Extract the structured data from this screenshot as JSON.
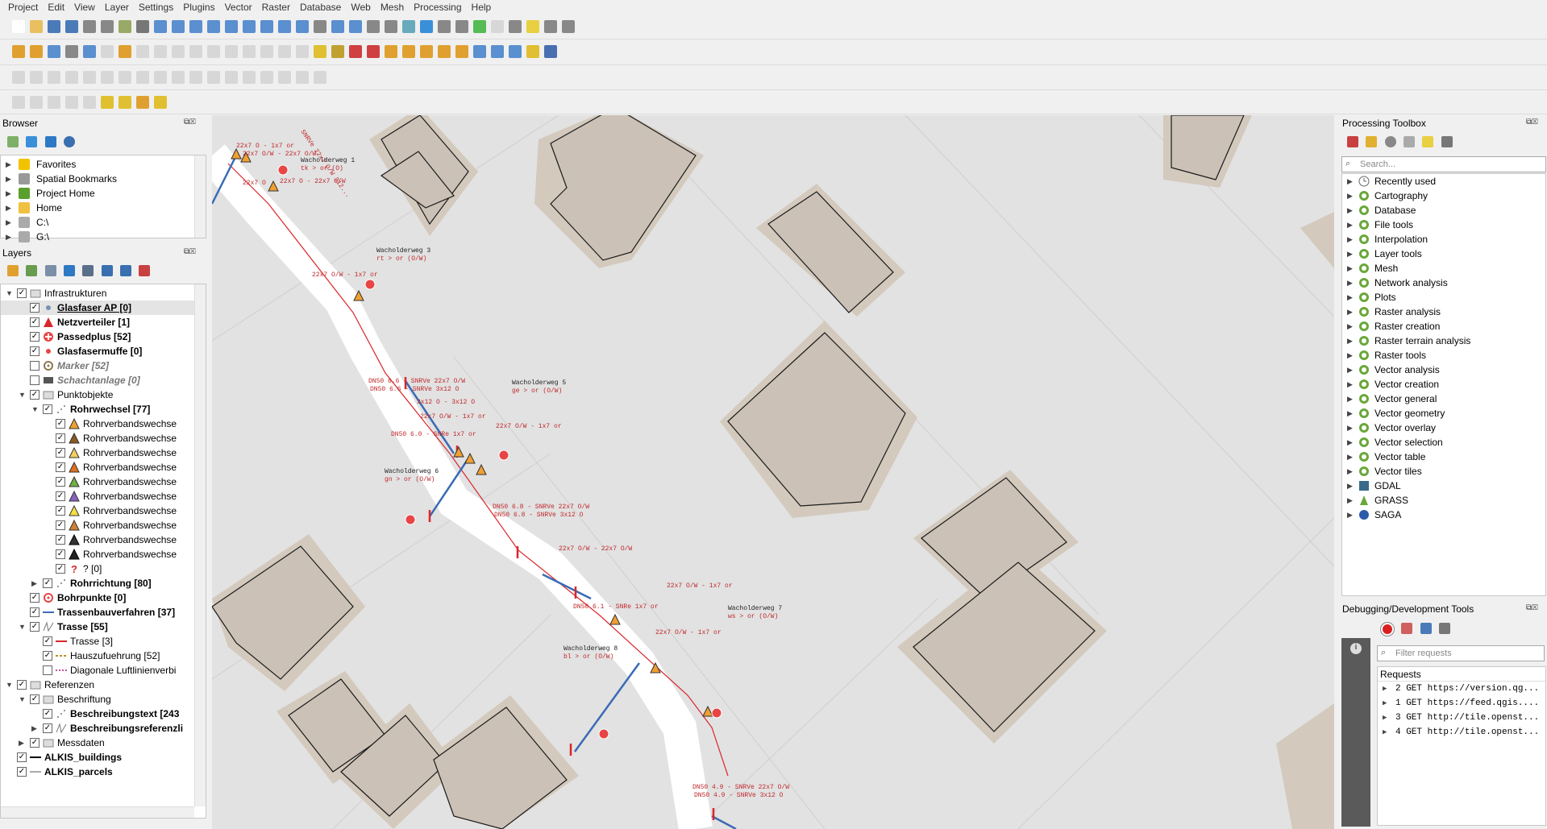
{
  "menu": [
    "Project",
    "Edit",
    "View",
    "Layer",
    "Settings",
    "Plugins",
    "Vector",
    "Raster",
    "Database",
    "Web",
    "Mesh",
    "Processing",
    "Help"
  ],
  "browser": {
    "title": "Browser",
    "items": [
      {
        "label": "Favorites",
        "icon": "star-icon"
      },
      {
        "label": "Spatial Bookmarks",
        "icon": "bookmark-icon"
      },
      {
        "label": "Project Home",
        "icon": "project-home-icon"
      },
      {
        "label": "Home",
        "icon": "folder-icon"
      },
      {
        "label": "C:\\",
        "icon": "drive-icon"
      },
      {
        "label": "G:\\",
        "icon": "drive-icon"
      }
    ]
  },
  "layers": {
    "title": "Layers",
    "items": [
      {
        "label": "Infrastrukturen",
        "level": 0,
        "expanded": true,
        "checked": true,
        "style": "",
        "sym": "group"
      },
      {
        "label": "Glasfaser AP [0]",
        "level": 1,
        "checked": true,
        "style": "b u",
        "sym": "dot-blue",
        "selected": true
      },
      {
        "label": "Netzverteiler [1]",
        "level": 1,
        "checked": true,
        "style": "b",
        "sym": "tri-red"
      },
      {
        "label": "Passedplus [52]",
        "level": 1,
        "checked": true,
        "style": "b",
        "sym": "plus-red"
      },
      {
        "label": "Glasfasermuffe [0]",
        "level": 1,
        "checked": true,
        "style": "b",
        "sym": "dot-red"
      },
      {
        "label": "Marker [52]",
        "level": 1,
        "checked": false,
        "style": "b it",
        "sym": "target-gray"
      },
      {
        "label": "Schachtanlage [0]",
        "level": 1,
        "checked": false,
        "style": "b it",
        "sym": "box-gray"
      },
      {
        "label": "Punktobjekte",
        "level": 1,
        "expanded": true,
        "checked": true,
        "style": "",
        "sym": "group"
      },
      {
        "label": "Rohrwechsel [77]",
        "level": 2,
        "expanded": true,
        "checked": true,
        "style": "b",
        "sym": "dots"
      },
      {
        "label": "Rohrverbandswechse",
        "level": 3,
        "checked": true,
        "style": "",
        "sym": "tri-orange"
      },
      {
        "label": "Rohrverbandswechse",
        "level": 3,
        "checked": true,
        "style": "",
        "sym": "tri-brown"
      },
      {
        "label": "Rohrverbandswechse",
        "level": 3,
        "checked": true,
        "style": "",
        "sym": "tri-yellow"
      },
      {
        "label": "Rohrverbandswechse",
        "level": 3,
        "checked": true,
        "style": "",
        "sym": "tri-orange2"
      },
      {
        "label": "Rohrverbandswechse",
        "level": 3,
        "checked": true,
        "style": "",
        "sym": "tri-green"
      },
      {
        "label": "Rohrverbandswechse",
        "level": 3,
        "checked": true,
        "style": "",
        "sym": "tri-multi"
      },
      {
        "label": "Rohrverbandswechse",
        "level": 3,
        "checked": true,
        "style": "",
        "sym": "tri-yellow2"
      },
      {
        "label": "Rohrverbandswechse",
        "level": 3,
        "checked": true,
        "style": "",
        "sym": "tri-orange3"
      },
      {
        "label": "Rohrverbandswechse",
        "level": 3,
        "checked": true,
        "style": "",
        "sym": "tri-black"
      },
      {
        "label": "Rohrverbandswechse",
        "level": 3,
        "checked": true,
        "style": "",
        "sym": "tri-black2"
      },
      {
        "label": "? [0]",
        "level": 3,
        "checked": true,
        "style": "",
        "sym": "question"
      },
      {
        "label": "Rohrrichtung [80]",
        "level": 2,
        "expanded": false,
        "checked": true,
        "style": "b",
        "sym": "dots"
      },
      {
        "label": "Bohrpunkte [0]",
        "level": 1,
        "checked": true,
        "style": "b",
        "sym": "target-red"
      },
      {
        "label": "Trassenbauverfahren [37]",
        "level": 1,
        "checked": true,
        "style": "b",
        "sym": "line-blue"
      },
      {
        "label": "Trasse [55]",
        "level": 1,
        "expanded": true,
        "checked": true,
        "style": "b",
        "sym": "line-check"
      },
      {
        "label": "Trasse [3]",
        "level": 2,
        "checked": true,
        "style": "",
        "sym": "line-red"
      },
      {
        "label": "Hauszufuehrung [52]",
        "level": 2,
        "checked": true,
        "style": "",
        "sym": "line-yellow"
      },
      {
        "label": "Diagonale Luftlinienverbi",
        "level": 2,
        "checked": false,
        "style": "",
        "sym": "line-pink"
      },
      {
        "label": "Referenzen",
        "level": 0,
        "expanded": true,
        "checked": true,
        "style": "",
        "sym": "group"
      },
      {
        "label": "Beschriftung",
        "level": 1,
        "expanded": true,
        "checked": true,
        "style": "",
        "sym": "group"
      },
      {
        "label": "Beschreibungstext [243",
        "level": 2,
        "checked": true,
        "style": "b",
        "sym": "dots"
      },
      {
        "label": "Beschreibungsreferenzli",
        "level": 2,
        "expanded": false,
        "checked": true,
        "style": "b",
        "sym": "line-check"
      },
      {
        "label": "Messdaten",
        "level": 1,
        "expanded": false,
        "checked": true,
        "style": "",
        "sym": "group"
      },
      {
        "label": "ALKIS_buildings",
        "level": 0,
        "checked": true,
        "style": "b",
        "sym": "line-black"
      },
      {
        "label": "ALKIS_parcels",
        "level": 0,
        "checked": true,
        "style": "b",
        "sym": "line-gray"
      }
    ]
  },
  "processing": {
    "title": "Processing Toolbox",
    "search_placeholder": "Search...",
    "items": [
      "Recently used",
      "Cartography",
      "Database",
      "File tools",
      "Interpolation",
      "Layer tools",
      "Mesh",
      "Network analysis",
      "Plots",
      "Raster analysis",
      "Raster creation",
      "Raster terrain analysis",
      "Raster tools",
      "Vector analysis",
      "Vector creation",
      "Vector general",
      "Vector geometry",
      "Vector overlay",
      "Vector selection",
      "Vector table",
      "Vector tiles",
      "GDAL",
      "GRASS",
      "SAGA"
    ]
  },
  "debug": {
    "title": "Debugging/Development Tools",
    "filter_placeholder": "Filter requests",
    "requests_header": "Requests",
    "requests": [
      "2 GET https://version.qg...",
      "1 GET https://feed.qgis....",
      "3 GET http://tile.openst...",
      "4 GET http://tile.openst..."
    ]
  },
  "map_labels": [
    {
      "text": "22x7 O - 1x7 or"
    },
    {
      "text": "22x7 O/W - 22x7 O/W"
    },
    {
      "text": "22x7 O"
    },
    {
      "text": "22x7 O - 22x7 O/W"
    },
    {
      "text": "Wacholderweg 1"
    },
    {
      "text": "tk > or (O)"
    },
    {
      "text": "Wacholderweg 3"
    },
    {
      "text": "rt > or (O/W)"
    },
    {
      "text": "22x7 O/W - 1x7 or"
    },
    {
      "text": "DN50 6.6 - SNRVe 22x7 O/W"
    },
    {
      "text": "DN50 6.6 - SNRVe 3x12 O"
    },
    {
      "text": "3x12 O - 3x12 O"
    },
    {
      "text": "22x7 O/W - 1x7 or"
    },
    {
      "text": "22x7 O/W - 1x7 or"
    },
    {
      "text": "Wacholderweg 5"
    },
    {
      "text": "ge > or (O/W)"
    },
    {
      "text": "DN50 6.0 - SNRe 1x7 or"
    },
    {
      "text": "Wacholderweg 6"
    },
    {
      "text": "gn > or (O/W)"
    },
    {
      "text": "DN50 6.8 - SNRVe 22x7 O/W"
    },
    {
      "text": "DN50 6.8 - SNRVe 3x12 O"
    },
    {
      "text": "22x7 O/W - 22x7 O/W"
    },
    {
      "text": "22x7 O/W - 1x7 or"
    },
    {
      "text": "Wacholderweg 7"
    },
    {
      "text": "ws > or (O/W)"
    },
    {
      "text": "DN50 6.1 - SNRe 1x7 or"
    },
    {
      "text": "22x7 O/W - 1x7 or"
    },
    {
      "text": "Wacholderweg 8"
    },
    {
      "text": "bl > or (O/W)"
    },
    {
      "text": "DN50 4.9 - SNRVe 22x7 O/W"
    },
    {
      "text": "DN50 4.9 - SNRVe 3x12 O"
    },
    {
      "text": "SNRVe 22x7 O/W 312..."
    }
  ]
}
